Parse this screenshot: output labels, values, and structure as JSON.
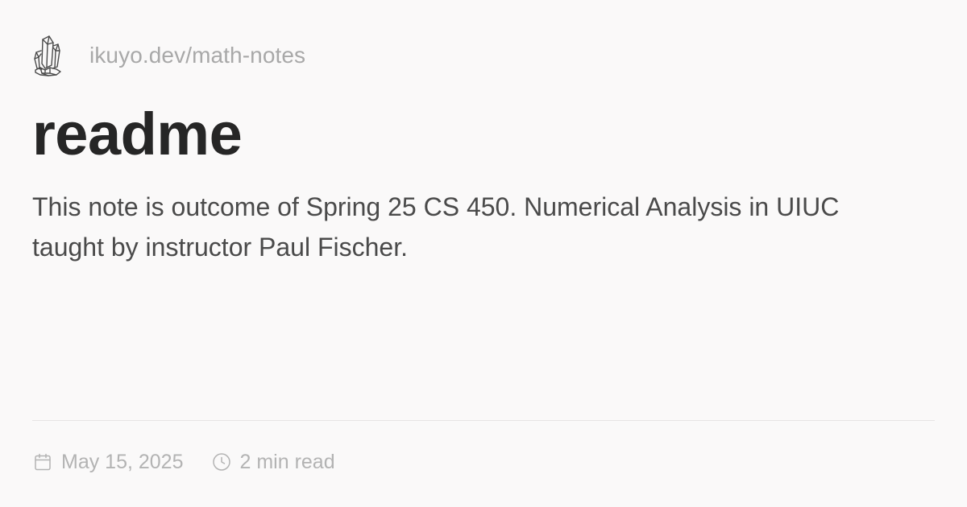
{
  "header": {
    "site_url": "ikuyo.dev/math-notes",
    "logo_icon": "crystal-cluster-icon"
  },
  "article": {
    "title": "readme",
    "description": "This note is outcome of Spring 25 CS 450. Numerical Analysis in UIUC taught by instructor Paul Fischer."
  },
  "meta": {
    "date_icon": "calendar-icon",
    "date": "May 15, 2025",
    "read_time_icon": "clock-icon",
    "read_time": "2 min read"
  },
  "colors": {
    "background": "#faf9f9",
    "title": "#262626",
    "body_text": "#4a4a4a",
    "muted_text": "#a8a8a8",
    "divider": "#e6e4e4"
  }
}
